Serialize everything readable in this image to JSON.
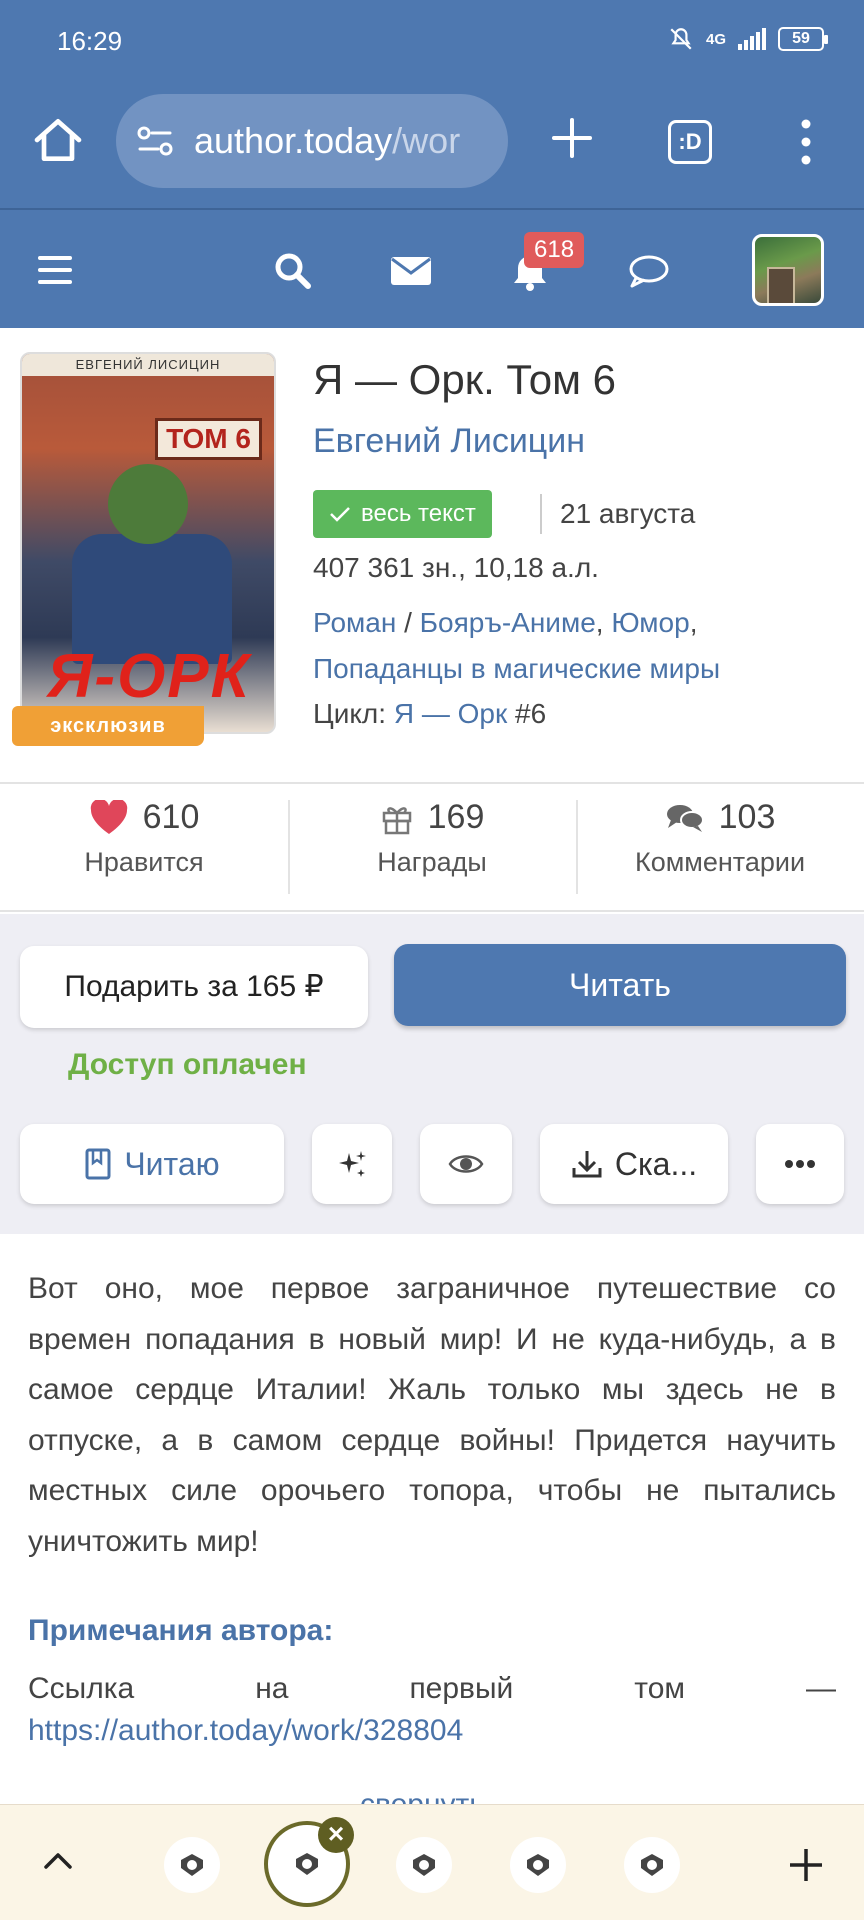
{
  "status_bar": {
    "time": "16:29",
    "network": "4G",
    "battery": "59"
  },
  "browser": {
    "url_domain": "author.today",
    "url_path": "/wor",
    "tabs_label": ":D"
  },
  "site_nav": {
    "notifications_count": "618"
  },
  "book": {
    "cover_author": "ЕВГЕНИЙ ЛИСИЦИН",
    "cover_tom": "ТОМ 6",
    "cover_title": "Я-ОРК",
    "exclusive_label": "эксклюзив",
    "title": "Я — Орк. Том 6",
    "author": "Евгений Лисицин",
    "status": "весь текст",
    "date": "21 августа",
    "stats": "407 361 зн., 10,18 а.л.",
    "genre_main": "Роман",
    "genre_sep": " / ",
    "genre_1": "Бояръ-Аниме",
    "genre_2": "Юмор",
    "genre_3": "Попаданцы в магические миры",
    "cycle_label": "Цикл: ",
    "cycle_name": "Я — Орк",
    "cycle_num": " #6"
  },
  "counters": {
    "likes": {
      "value": "610",
      "label": "Нравится"
    },
    "awards": {
      "value": "169",
      "label": "Награды"
    },
    "comments": {
      "value": "103",
      "label": "Комментарии"
    }
  },
  "actions": {
    "gift_label": "Подарить за 165 ₽",
    "read_label": "Читать",
    "paid_label": "Доступ оплачен",
    "reading_label": "Читаю",
    "download_label": "Ска..."
  },
  "description": "Вот оно, мое первое заграничное путешествие со времен попадания в новый мир! И не куда-нибудь, а в самое сердце Италии! Жаль только мы здесь не в отпуске, а в самом сердце войны! Придется научить местных силе орочьего топора, чтобы не пытались уничтожить мир!",
  "author_notes": {
    "heading": "Примечания автора:",
    "w1": "Ссылка",
    "w2": "на",
    "w3": "первый",
    "w4": "том",
    "w5": "—",
    "link": "https://author.today/work/328804",
    "collapse": "свернуть"
  },
  "colors": {
    "brand": "#4e78b0",
    "success": "#5cb85c",
    "exclusive": "#f0a036",
    "badge": "#e05b5b"
  }
}
